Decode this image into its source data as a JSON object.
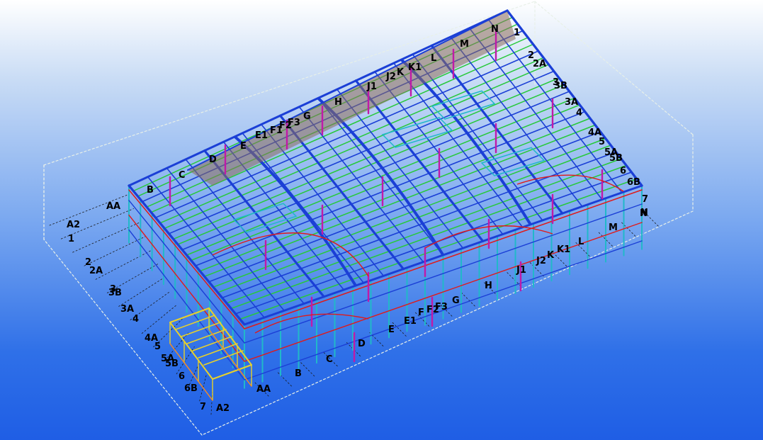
{
  "colors": {
    "rafter": "#1b3fd6",
    "purlin": "#27c93a",
    "brace": "#e01a1a",
    "column": "#c01aa8",
    "cyan": "#21b8c9",
    "stair": "#e8d12a",
    "grid": "#1a1a1a",
    "box": "#e8f0e8"
  },
  "grid_labels": {
    "left_axis": [
      "A2",
      "1",
      "2",
      "2A",
      "3",
      "3B",
      "3A",
      "4",
      "4A",
      "5",
      "5A",
      "5B",
      "6",
      "6B",
      "7",
      "A2"
    ],
    "front_axis": [
      "AA",
      "B",
      "C",
      "D",
      "E",
      "E1",
      "F",
      "F2",
      "F3",
      "G",
      "H",
      "J1",
      "J2",
      "K",
      "K1",
      "L",
      "M",
      "N"
    ],
    "top_axis": [
      "AA",
      "B",
      "C",
      "D",
      "E",
      "E1",
      "F1",
      "F2",
      "F3",
      "G",
      "H",
      "J1",
      "J2",
      "K",
      "K1",
      "L",
      "M",
      "N"
    ],
    "right_axis": [
      "1",
      "2",
      "2A",
      "3",
      "3B",
      "3A",
      "4",
      "4A",
      "5",
      "5A",
      "5B",
      "6",
      "6B",
      "7",
      "N"
    ]
  }
}
